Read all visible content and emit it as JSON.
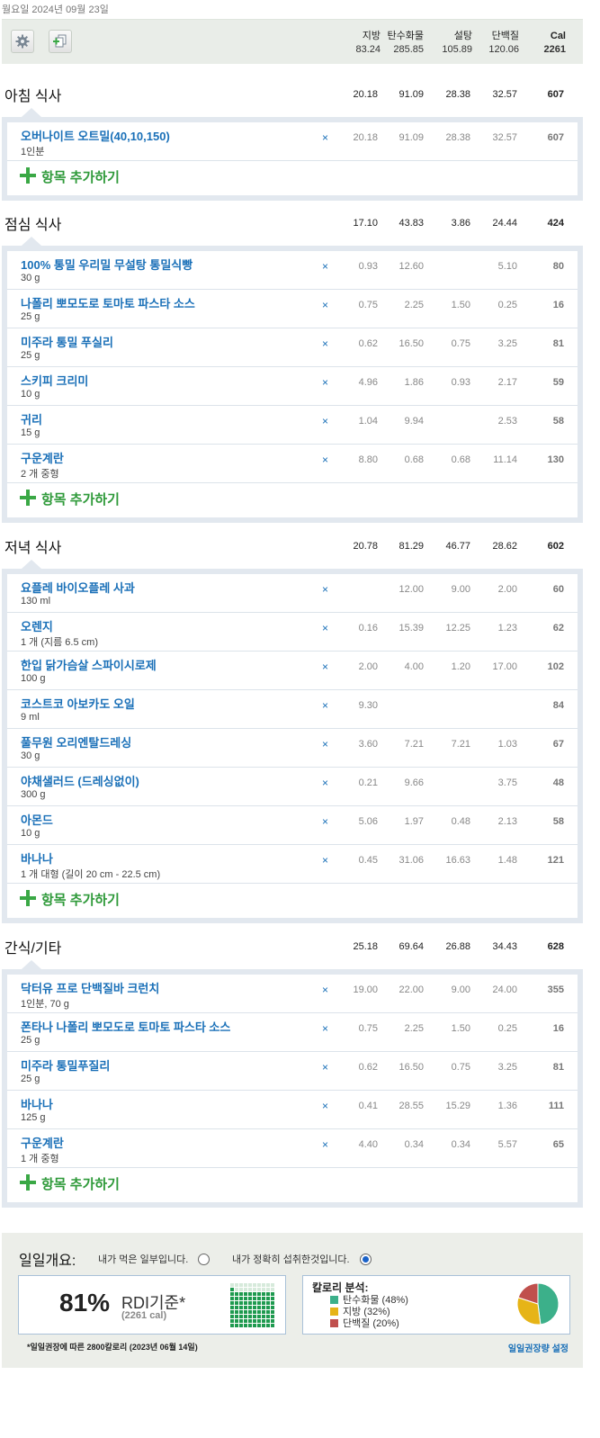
{
  "date": "월요일 2024년 09월 23일",
  "toolbar": {
    "settings_icon": "gear-icon",
    "copy_icon": "copy-add-icon"
  },
  "columns": {
    "fat": "지방",
    "carbs": "탄수화물",
    "sugar": "설탕",
    "protein": "단백질",
    "cal": "Cal"
  },
  "totals": {
    "fat": "83.24",
    "carbs": "285.85",
    "sugar": "105.89",
    "protein": "120.06",
    "cal": "2261"
  },
  "add_label": "항목 추가하기",
  "meals": [
    {
      "title": "아침 식사",
      "totals": [
        "20.18",
        "91.09",
        "28.38",
        "32.57",
        "607"
      ],
      "items": [
        {
          "name": "오버나이트 오트밀(40,10,150)",
          "qty": "1인분",
          "vals": [
            "20.18",
            "91.09",
            "28.38",
            "32.57",
            "607"
          ]
        }
      ]
    },
    {
      "title": "점심 식사",
      "totals": [
        "17.10",
        "43.83",
        "3.86",
        "24.44",
        "424"
      ],
      "items": [
        {
          "name": "100% 통밀 우리밀 무설탕 통밀식빵",
          "qty": "30 g",
          "vals": [
            "0.93",
            "12.60",
            "",
            "5.10",
            "80"
          ]
        },
        {
          "name": "나폴리 뽀모도로 토마토 파스타 소스",
          "qty": "25 g",
          "vals": [
            "0.75",
            "2.25",
            "1.50",
            "0.25",
            "16"
          ]
        },
        {
          "name": "미주라 통밀 푸실리",
          "qty": "25 g",
          "vals": [
            "0.62",
            "16.50",
            "0.75",
            "3.25",
            "81"
          ]
        },
        {
          "name": "스키피 크리미",
          "qty": "10 g",
          "vals": [
            "4.96",
            "1.86",
            "0.93",
            "2.17",
            "59"
          ]
        },
        {
          "name": "귀리",
          "qty": "15 g",
          "vals": [
            "1.04",
            "9.94",
            "",
            "2.53",
            "58"
          ]
        },
        {
          "name": "구운계란",
          "qty": "2 개 중형",
          "vals": [
            "8.80",
            "0.68",
            "0.68",
            "11.14",
            "130"
          ]
        }
      ]
    },
    {
      "title": "저녁 식사",
      "totals": [
        "20.78",
        "81.29",
        "46.77",
        "28.62",
        "602"
      ],
      "items": [
        {
          "name": "요플레 바이오플레 사과",
          "qty": "130 ml",
          "vals": [
            "",
            "12.00",
            "9.00",
            "2.00",
            "60"
          ]
        },
        {
          "name": "오렌지",
          "qty": "1 개 (지름 6.5 cm)",
          "vals": [
            "0.16",
            "15.39",
            "12.25",
            "1.23",
            "62"
          ]
        },
        {
          "name": "한입 닭가슴살 스파이시로제",
          "qty": "100 g",
          "vals": [
            "2.00",
            "4.00",
            "1.20",
            "17.00",
            "102"
          ]
        },
        {
          "name": "코스트코 아보카도 오일",
          "qty": "9 ml",
          "vals": [
            "9.30",
            "",
            "",
            "",
            "84"
          ]
        },
        {
          "name": "풀무원 오리엔탈드레싱",
          "qty": "30 g",
          "vals": [
            "3.60",
            "7.21",
            "7.21",
            "1.03",
            "67"
          ]
        },
        {
          "name": "야채샐러드 (드레싱없이)",
          "qty": "300 g",
          "vals": [
            "0.21",
            "9.66",
            "",
            "3.75",
            "48"
          ]
        },
        {
          "name": "아몬드",
          "qty": "10 g",
          "vals": [
            "5.06",
            "1.97",
            "0.48",
            "2.13",
            "58"
          ]
        },
        {
          "name": "바나나",
          "qty": "1 개 대형 (길이 20 cm - 22.5 cm)",
          "vals": [
            "0.45",
            "31.06",
            "16.63",
            "1.48",
            "121"
          ]
        }
      ]
    },
    {
      "title": "간식/기타",
      "totals": [
        "25.18",
        "69.64",
        "26.88",
        "34.43",
        "628"
      ],
      "items": [
        {
          "name": "닥터유 프로 단백질바 크런치",
          "qty": "1인분, 70 g",
          "vals": [
            "19.00",
            "22.00",
            "9.00",
            "24.00",
            "355"
          ]
        },
        {
          "name": "폰타나 나폴리 뽀모도로 토마토 파스타 소스",
          "qty": "25 g",
          "vals": [
            "0.75",
            "2.25",
            "1.50",
            "0.25",
            "16"
          ]
        },
        {
          "name": "미주라 통밀푸질리",
          "qty": "25 g",
          "vals": [
            "0.62",
            "16.50",
            "0.75",
            "3.25",
            "81"
          ]
        },
        {
          "name": "바나나",
          "qty": "125 g",
          "vals": [
            "0.41",
            "28.55",
            "15.29",
            "1.36",
            "111"
          ]
        },
        {
          "name": "구운계란",
          "qty": "1 개 중형",
          "vals": [
            "4.40",
            "0.34",
            "0.34",
            "5.57",
            "65"
          ]
        }
      ]
    }
  ],
  "summary": {
    "title": "일일개요:",
    "option_partial": "내가 먹은 일부입니다.",
    "option_full": "내가 정확히 섭취한것입니다.",
    "selected": "full",
    "percent": "81%",
    "rdi_label": "RDI기준*",
    "rdi_cal": "(2261 cal)",
    "rdi_fraction": 0.81,
    "breakdown_title": "칼로리 분석:",
    "breakdown": [
      {
        "label": "탄수화물 (48%)",
        "pct": 48,
        "color": "#3cb08a"
      },
      {
        "label": "지방 (32%)",
        "pct": 32,
        "color": "#e6b417"
      },
      {
        "label": "단백질 (20%)",
        "pct": 20,
        "color": "#c0504d"
      }
    ],
    "footnote": "*일일권장에 따른 2800칼로리 (2023년 06월 14일)",
    "settings_link": "일일권장량 설정"
  }
}
